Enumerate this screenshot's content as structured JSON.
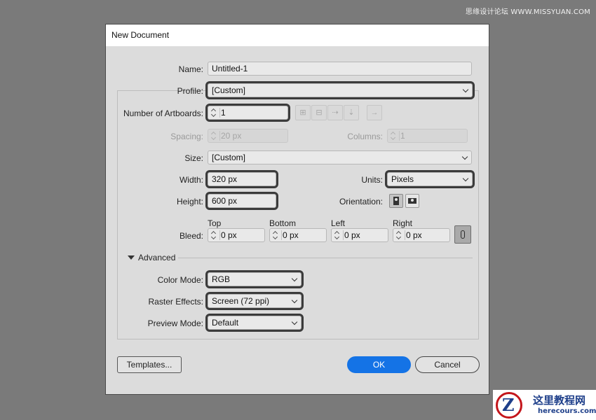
{
  "watermark_top": "思缘设计论坛 WWW.MISSYUAN.COM",
  "dialog": {
    "title": "New Document"
  },
  "name": {
    "label": "Name:",
    "value": "Untitled-1"
  },
  "profile": {
    "label": "Profile:",
    "value": "[Custom]"
  },
  "artboards": {
    "label": "Number of Artboards:",
    "value": "1",
    "arrange_icons": [
      "grid-by-row-icon",
      "grid-by-column-icon",
      "arrange-by-row-icon",
      "arrange-by-column-icon",
      "right-to-left-icon"
    ]
  },
  "spacing": {
    "label": "Spacing:",
    "value": "20 px"
  },
  "columns": {
    "label": "Columns:",
    "value": "1"
  },
  "size": {
    "label": "Size:",
    "value": "[Custom]"
  },
  "width": {
    "label": "Width:",
    "value": "320 px"
  },
  "units": {
    "label": "Units:",
    "value": "Pixels"
  },
  "height": {
    "label": "Height:",
    "value": "600 px"
  },
  "orientation": {
    "label": "Orientation:",
    "selected": "portrait"
  },
  "bleed": {
    "label": "Bleed:",
    "top": {
      "label": "Top",
      "value": "0 px"
    },
    "bottom": {
      "label": "Bottom",
      "value": "0 px"
    },
    "left": {
      "label": "Left",
      "value": "0 px"
    },
    "right": {
      "label": "Right",
      "value": "0 px"
    }
  },
  "advanced": {
    "label": "Advanced",
    "color_mode": {
      "label": "Color Mode:",
      "value": "RGB"
    },
    "raster_effects": {
      "label": "Raster Effects:",
      "value": "Screen (72 ppi)"
    },
    "preview_mode": {
      "label": "Preview Mode:",
      "value": "Default"
    }
  },
  "buttons": {
    "templates": "Templates...",
    "ok": "OK",
    "cancel": "Cancel"
  },
  "watermark_bottom": {
    "logo_letter": "Z",
    "title": "这里教程网",
    "url": "herecours.com"
  },
  "colors": {
    "accent": "#1473e6",
    "highlight": "#3b3b3b",
    "watermark_red": "#c4161c",
    "watermark_blue": "#1e3f8a"
  }
}
